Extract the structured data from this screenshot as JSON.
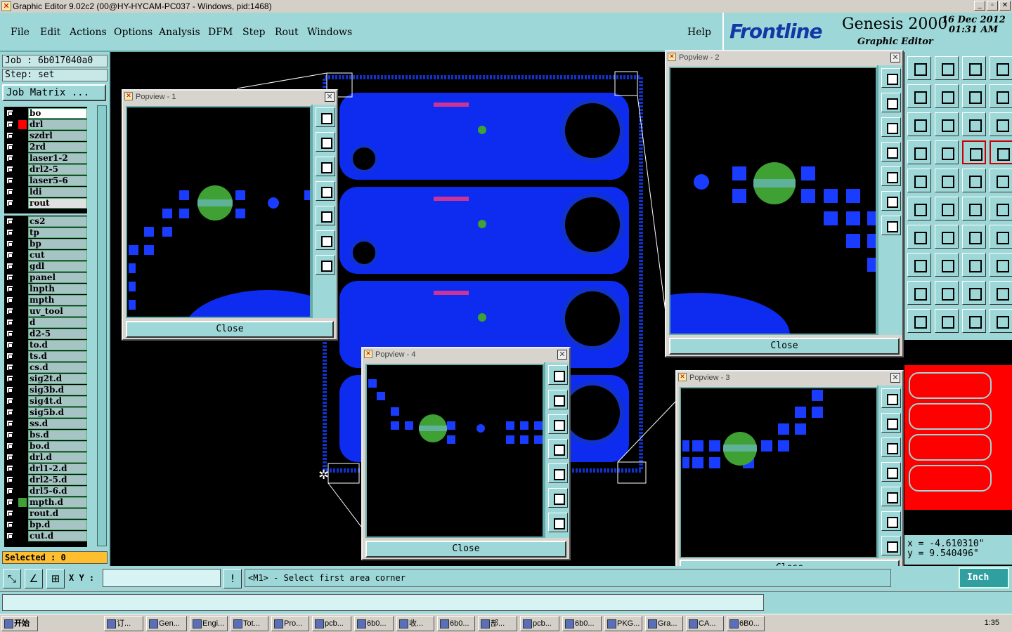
{
  "window": {
    "title": "Graphic Editor 9.02c2 (00@HY-HYCAM-PC037 - Windows, pid:1468)"
  },
  "menu": [
    "File",
    "Edit",
    "Actions",
    "Options",
    "Analysis",
    "DFM",
    "Step",
    "Rout",
    "Windows"
  ],
  "help_label": "Help",
  "brand": {
    "logo": "Frontline",
    "product": "Genesis 2000",
    "subtitle": "Graphic Editor",
    "date": "16 Dec 2012",
    "time": "01:31 AM"
  },
  "job": "Job : 6b017040a0",
  "step": "Step: set",
  "job_matrix_label": "Job Matrix ...",
  "layers_board": [
    "bo",
    "drl",
    "szdrl",
    "2rd",
    "laser1-2",
    "drl2-5",
    "laser5-6",
    "ldi",
    "rout"
  ],
  "layers_misc": [
    "cs2",
    "tp",
    "bp",
    "cut",
    "gdl",
    "panel",
    "lnpth",
    "mpth",
    "uv_tool",
    "d",
    "d2-5",
    "to.d",
    "ts.d",
    "cs.d",
    "sig2t.d",
    "sig3b.d",
    "sig4t.d",
    "sig5b.d",
    "ss.d",
    "bs.d",
    "bo.d",
    "drl.d",
    "drl1-2.d",
    "drl2-5.d",
    "drl5-6.d",
    "mpth.d",
    "rout.d",
    "bp.d",
    "cut.d"
  ],
  "selected": "Selected : 0",
  "xy_label": "X Y :",
  "status": "<M1> - Select first area corner",
  "unit": "Inch",
  "coords": {
    "x": "x = -4.610310\"",
    "y": "y = 9.540496\""
  },
  "popviews": [
    {
      "title": "Popview - 1",
      "close": "Close"
    },
    {
      "title": "Popview - 2",
      "close": "Close"
    },
    {
      "title": "Popview - 3",
      "close": "Close"
    },
    {
      "title": "Popview - 4",
      "close": "Close"
    }
  ],
  "taskbar": {
    "start": "开始",
    "clock": "1:35",
    "tasks": [
      "订...",
      "Gen...",
      "Engi...",
      "Tot...",
      "Pro...",
      "pcb...",
      "6b0...",
      "收...",
      "6b0...",
      "部...",
      "pcb...",
      "6b0...",
      "PKG...",
      "Gra...",
      "CA...",
      "6B0..."
    ]
  },
  "colors": {
    "panel": "#9ed7d7",
    "board": "#0d2cf0",
    "pad": "#1a3cff",
    "via": "#3fa033",
    "cursor": "#ffbe2e",
    "rout": "#ff0000"
  }
}
